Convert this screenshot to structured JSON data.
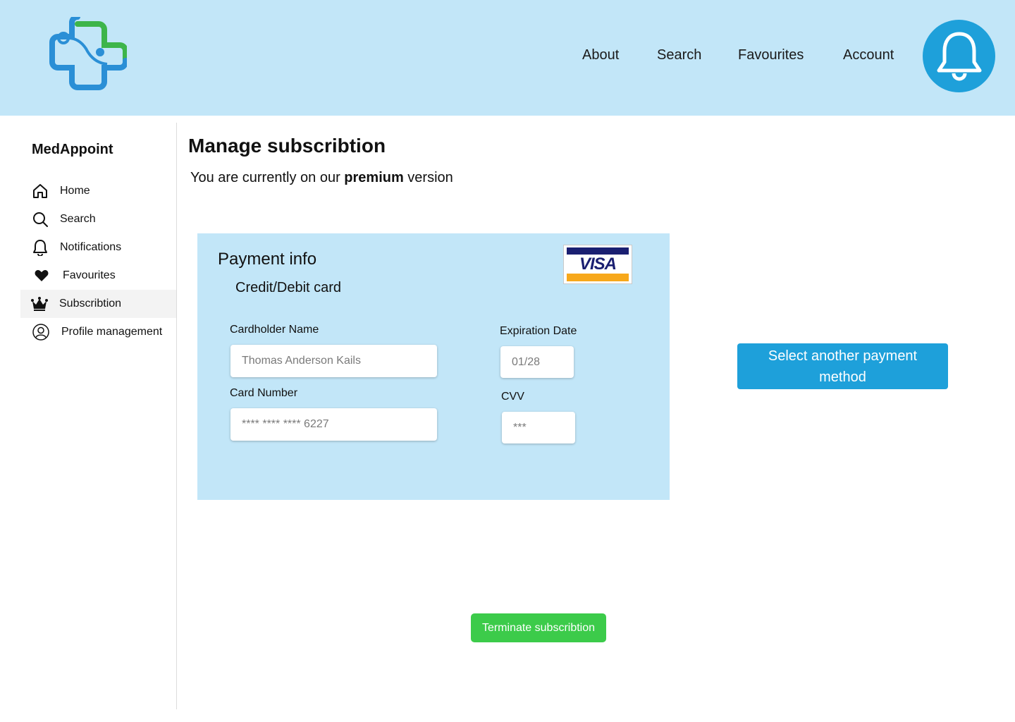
{
  "header": {
    "nav": [
      {
        "label": "About"
      },
      {
        "label": "Search"
      },
      {
        "label": "Favourites"
      },
      {
        "label": "Account"
      }
    ],
    "notification_icon": "bell-icon",
    "logo_icon": "medical-cross-stethoscope-logo"
  },
  "sidebar": {
    "brand": "MedAppoint",
    "items": [
      {
        "label": "Home",
        "icon": "home-icon",
        "active": false
      },
      {
        "label": "Search",
        "icon": "search-icon",
        "active": false
      },
      {
        "label": "Notifications",
        "icon": "bell-icon",
        "active": false
      },
      {
        "label": "Favourites",
        "icon": "heart-icon",
        "active": false
      },
      {
        "label": "Subscribtion",
        "icon": "crown-icon",
        "active": true
      },
      {
        "label": "Profile management",
        "icon": "user-circle-icon",
        "active": false
      }
    ]
  },
  "main": {
    "title": "Manage subscribtion",
    "status_prefix": "You are currently on our ",
    "status_plan": "premium",
    "status_suffix": " version"
  },
  "payment": {
    "title": "Payment info",
    "method": "Credit/Debit card",
    "card_brand": "VISA",
    "cardholder_label": "Cardholder Name",
    "cardholder_value": "Thomas Anderson Kails",
    "card_number_label": "Card Number",
    "card_number_value": "**** **** **** 6227",
    "expiration_label": "Expiration Date",
    "expiration_value": "01/28",
    "cvv_label": "CVV",
    "cvv_value": "***"
  },
  "actions": {
    "select_method": "Select another payment method",
    "terminate": "Terminate subscribtion"
  },
  "colors": {
    "header_bg": "#c2e6f8",
    "accent_blue": "#1ea0da",
    "green": "#3ccb4a",
    "visa_blue": "#1a1f71",
    "visa_gold": "#f7a81b"
  }
}
